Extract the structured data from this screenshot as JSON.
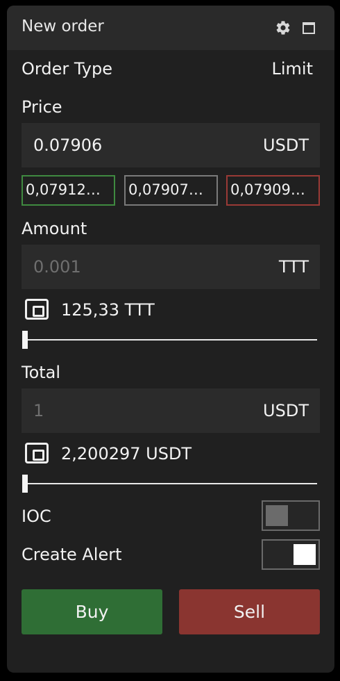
{
  "header": {
    "title": "New order",
    "settings_icon": "gear-icon",
    "window_icon": "maximize-icon"
  },
  "order_type": {
    "label": "Order Type",
    "value": "Limit"
  },
  "price": {
    "label": "Price",
    "value": "0.07906",
    "unit": "USDT",
    "quick_prices": [
      "0,07912…",
      "0,07907…",
      "0,07909…"
    ]
  },
  "amount": {
    "label": "Amount",
    "placeholder": "0.001",
    "unit": "TTT",
    "balance": "125,33 TTT",
    "slider_fraction": 0
  },
  "total": {
    "label": "Total",
    "placeholder": "1",
    "unit": "USDT",
    "balance": "2,200297 USDT",
    "slider_fraction": 0
  },
  "ioc": {
    "label": "IOC",
    "enabled": false
  },
  "create_alert": {
    "label": "Create Alert",
    "enabled": true
  },
  "actions": {
    "buy_label": "Buy",
    "sell_label": "Sell"
  },
  "colors": {
    "buy": "#2f6e35",
    "sell": "#8a3530",
    "bid_border": "#3f8a40",
    "ask_border": "#9a3a36"
  }
}
